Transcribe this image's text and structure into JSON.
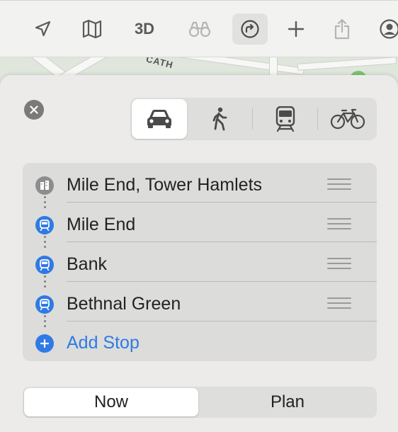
{
  "toolbar": {
    "items": [
      {
        "name": "location-arrow-icon"
      },
      {
        "name": "map-icon"
      },
      {
        "name": "3d-button",
        "label": "3D"
      },
      {
        "name": "binoculars-icon",
        "dim": true
      },
      {
        "name": "directions-icon",
        "active": true
      },
      {
        "name": "plus-icon"
      },
      {
        "name": "share-icon",
        "dim": true
      },
      {
        "name": "account-icon"
      }
    ]
  },
  "map": {
    "street_label": "CATH"
  },
  "transport_modes": [
    {
      "name": "car",
      "selected": true
    },
    {
      "name": "walk",
      "selected": false
    },
    {
      "name": "transit",
      "selected": false
    },
    {
      "name": "cycle",
      "selected": false
    }
  ],
  "stops": [
    {
      "label": "Mile End, Tower Hamlets",
      "type": "place"
    },
    {
      "label": "Mile End",
      "type": "train"
    },
    {
      "label": "Bank",
      "type": "train"
    },
    {
      "label": "Bethnal Green",
      "type": "train"
    }
  ],
  "add_stop": {
    "label": "Add Stop"
  },
  "time_options": [
    {
      "label": "Now",
      "selected": true
    },
    {
      "label": "Plan",
      "selected": false
    }
  ],
  "colors": {
    "accent": "#2f7ae5",
    "panel": "#ecebea"
  }
}
